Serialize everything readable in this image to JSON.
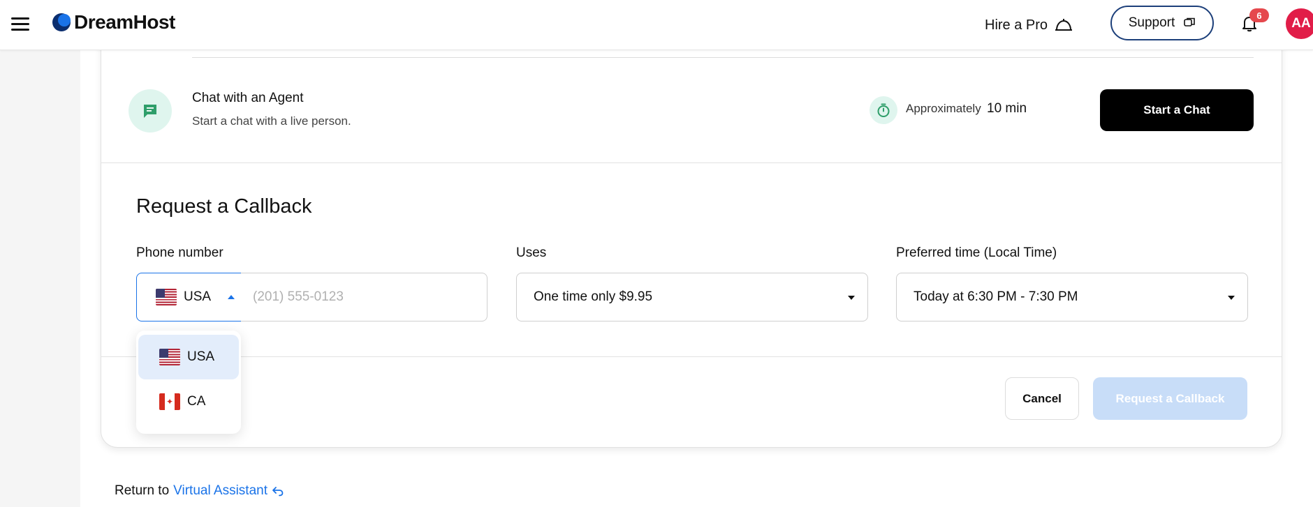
{
  "header": {
    "brand": "DreamHost",
    "hire_pro": "Hire a Pro",
    "support": "Support",
    "notification_count": "6",
    "avatar_initials": "AA"
  },
  "chat": {
    "title": "Chat with an Agent",
    "subtitle": "Start a chat with a live person.",
    "approx_label": "Approximately",
    "approx_value": "10 min",
    "button": "Start a Chat"
  },
  "callback": {
    "title": "Request a Callback",
    "phone_label": "Phone number",
    "country_selected": "USA",
    "phone_placeholder": "(201) 555-0123",
    "uses_label": "Uses",
    "uses_value": "One time only $9.95",
    "time_label": "Preferred time (Local Time)",
    "time_value": "Today at 6:30 PM - 7:30 PM",
    "country_options": [
      "USA",
      "CA"
    ],
    "cancel": "Cancel",
    "submit": "Request a Callback"
  },
  "footer": {
    "return_prefix": "Return to",
    "return_link": "Virtual Assistant"
  },
  "colors": {
    "accent": "#1a73e8",
    "badge": "#e5484d",
    "avatar": "#e11d48",
    "icon_bg": "#dff5ee",
    "icon_fg": "#2e9e6a"
  },
  "icons": [
    "menu-icon",
    "dreamhost-logo-icon",
    "hire-pro-icon",
    "support-chat-icon",
    "bell-icon",
    "chat-icon",
    "timer-icon",
    "us-flag-icon",
    "ca-flag-icon",
    "return-arrow-icon"
  ]
}
